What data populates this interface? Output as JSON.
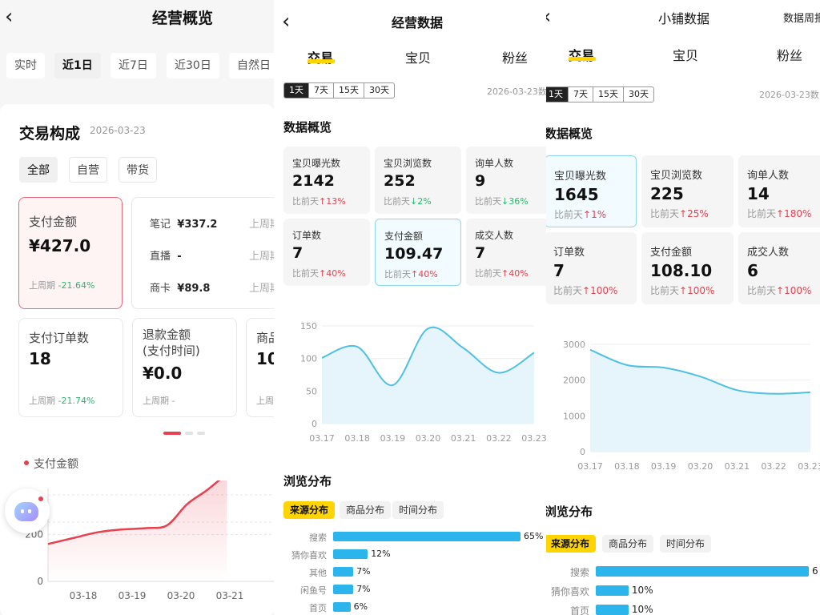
{
  "p1": {
    "title": "经营概览",
    "time_tabs": [
      "实时",
      "近1日",
      "近7日",
      "近30日",
      "自然日"
    ],
    "active_time_tab": 1,
    "card_title": "交易构成",
    "date": "2026-03-23",
    "filters": [
      "全部",
      "自营",
      "带货"
    ],
    "pay": {
      "label": "支付金额",
      "value": "¥427.0",
      "cmp_label": "上周期",
      "cmp": "-21.64%"
    },
    "breakdown": [
      {
        "label": "笔记",
        "value": "¥337.2",
        "cmp": "上周期"
      },
      {
        "label": "直播",
        "value": "-",
        "cmp": "上周期"
      },
      {
        "label": "商卡",
        "value": "¥89.8",
        "cmp": "上周期"
      }
    ],
    "orders": {
      "label": "支付订单数",
      "value": "18",
      "cmp_label": "上周期",
      "cmp": "-21.74%"
    },
    "refund": {
      "label": "退款金额\n(支付时间)",
      "value": "¥0.0",
      "cmp_label": "上周期",
      "cmp": "-"
    },
    "third": {
      "label": "商品",
      "value": "10",
      "cmp_label": "上周"
    },
    "legend": "支付金额",
    "chart_data": {
      "type": "line",
      "x": [
        "03-18",
        "03-19",
        "03-20",
        "03-21"
      ],
      "y_ticks": [
        0,
        200
      ],
      "series": [
        {
          "name": "支付金额",
          "points": [
            [
              0,
              160
            ],
            [
              0.5,
              185
            ],
            [
              1,
              210
            ],
            [
              1.5,
              222
            ],
            [
              2,
              228
            ],
            [
              2.4,
              240
            ],
            [
              2.8,
              330
            ],
            [
              3.2,
              390
            ],
            [
              3.6,
              460
            ]
          ]
        }
      ],
      "ylim": [
        0,
        500
      ]
    }
  },
  "p2": {
    "title": "经营数据",
    "tabs": [
      "交易",
      "宝贝",
      "粉丝"
    ],
    "ranges": [
      "1天",
      "7天",
      "15天",
      "30天"
    ],
    "date": "2026-03-23数",
    "overview_title": "数据概览",
    "metrics": [
      {
        "label": "宝贝曝光数",
        "value": "2142",
        "cmp": "比前天",
        "dir": "up",
        "pct": "13%"
      },
      {
        "label": "宝贝浏览数",
        "value": "252",
        "cmp": "比前天",
        "dir": "down",
        "pct": "2%"
      },
      {
        "label": "询单人数",
        "value": "9",
        "cmp": "比前天",
        "dir": "down",
        "pct": "36%"
      },
      {
        "label": "订单数",
        "value": "7",
        "cmp": "比前天",
        "dir": "up",
        "pct": "40%"
      },
      {
        "label": "支付金额",
        "value": "109.47",
        "cmp": "比前天",
        "dir": "up",
        "pct": "40%"
      },
      {
        "label": "成交人数",
        "value": "7",
        "cmp": "比前天",
        "dir": "up",
        "pct": "40%"
      }
    ],
    "chart_data": {
      "type": "area",
      "x": [
        "03.17",
        "03.18",
        "03.19",
        "03.20",
        "03.21",
        "03.22",
        "03.23"
      ],
      "y_ticks": [
        0,
        50,
        100,
        150
      ],
      "ylim": [
        0,
        150
      ],
      "series": [
        {
          "values": [
            101,
            118,
            59,
            146,
            116,
            78,
            109
          ]
        }
      ]
    },
    "dist_title": "浏览分布",
    "dist_tabs": [
      "来源分布",
      "商品分布",
      "时间分布"
    ],
    "bars": [
      {
        "label": "搜索",
        "value": 65,
        "text": "65%"
      },
      {
        "label": "猜你喜欢",
        "value": 12,
        "text": "12%"
      },
      {
        "label": "其他",
        "value": 7,
        "text": "7%"
      },
      {
        "label": "闲鱼号",
        "value": 7,
        "text": "7%"
      },
      {
        "label": "首页",
        "value": 6,
        "text": "6%"
      }
    ]
  },
  "p3": {
    "title": "小铺数据",
    "title_right": "数据周报",
    "tabs": [
      "交易",
      "宝贝",
      "粉丝"
    ],
    "ranges": [
      "1天",
      "7天",
      "15天",
      "30天"
    ],
    "date": "2026-03-23数",
    "overview_title": "数据概览",
    "metrics": [
      {
        "label": "宝贝曝光数",
        "value": "1645",
        "cmp": "比前天",
        "dir": "up",
        "pct": "1%"
      },
      {
        "label": "宝贝浏览数",
        "value": "225",
        "cmp": "比前天",
        "dir": "up",
        "pct": "25%"
      },
      {
        "label": "询单人数",
        "value": "14",
        "cmp": "比前天",
        "dir": "up",
        "pct": "180%"
      },
      {
        "label": "订单数",
        "value": "7",
        "cmp": "比前天",
        "dir": "up",
        "pct": "100%"
      },
      {
        "label": "支付金额",
        "value": "108.10",
        "cmp": "比前天",
        "dir": "up",
        "pct": "100%"
      },
      {
        "label": "成交人数",
        "value": "6",
        "cmp": "比前天",
        "dir": "up",
        "pct": "100%"
      }
    ],
    "chart_data": {
      "type": "area",
      "x": [
        "03.17",
        "03.18",
        "03.19",
        "03.20",
        "03.21",
        "03.22",
        "03.23"
      ],
      "y_ticks": [
        0,
        1000,
        2000,
        3000
      ],
      "ylim": [
        0,
        3000
      ],
      "series": [
        {
          "values": [
            2850,
            2420,
            2350,
            2100,
            1720,
            1620,
            1660
          ]
        }
      ]
    },
    "dist_title": "浏览分布",
    "dist_tabs": [
      "来源分布",
      "商品分布",
      "时间分布"
    ],
    "bars": [
      {
        "label": "搜索",
        "value": 65,
        "text": "6"
      },
      {
        "label": "猜你喜欢",
        "value": 10,
        "text": "10%"
      },
      {
        "label": "首页",
        "value": 10,
        "text": "10%"
      }
    ]
  }
}
